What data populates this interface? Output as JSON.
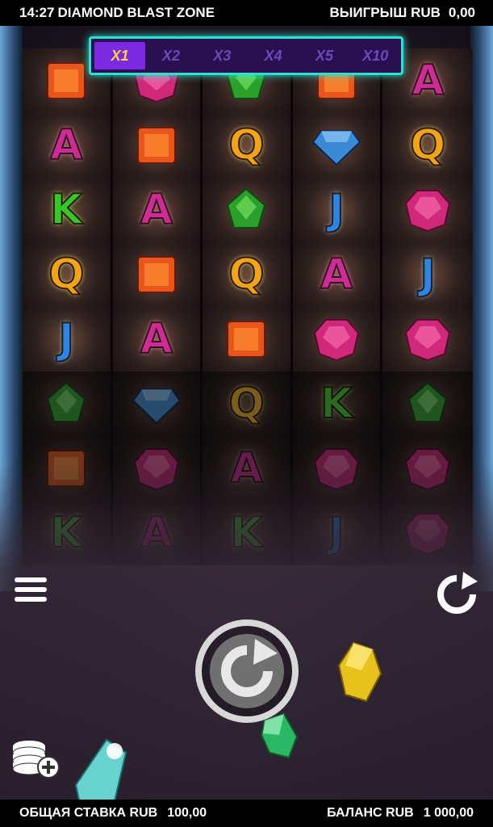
{
  "header": {
    "time": "14:27",
    "game_title": "DIAMOND BLAST ZONE",
    "win_label": "ВЫИГРЫШ RUB",
    "win_value": "0,00"
  },
  "footer": {
    "bet_label": "ОБЩАЯ СТАВКА RUB",
    "bet_value": "100,00",
    "balance_label": "БАЛАНС RUB",
    "balance_value": "1 000,00"
  },
  "multipliers": {
    "items": [
      "X1",
      "X2",
      "X3",
      "X4",
      "X5",
      "X10"
    ],
    "active_index": 0
  },
  "reels": [
    [
      "orange-gem",
      "A",
      "K",
      "Q",
      "J",
      "green-gem",
      "orange-gem",
      "K"
    ],
    [
      "pink-gem",
      "orange-gem",
      "A",
      "orange-gem",
      "A",
      "blue-diamond",
      "pink-gem",
      "A"
    ],
    [
      "green-gem",
      "Q",
      "green-gem",
      "Q",
      "orange-gem",
      "Q",
      "A",
      "K"
    ],
    [
      "orange-gem",
      "blue-diamond",
      "J",
      "A",
      "pink-gem",
      "K",
      "pink-gem",
      "J"
    ],
    [
      "A",
      "Q",
      "pink-gem",
      "J",
      "pink-gem",
      "green-gem",
      "pink-gem",
      "pink-gem"
    ]
  ],
  "colors": {
    "pink": "#d0287a",
    "orange": "#e8561a",
    "green": "#2aa02a",
    "blue": "#3a8ad6",
    "multiplier_frame": "#2ee0d0",
    "active_multiplier": "#ffd23a"
  },
  "icons": {
    "menu": "hamburger-icon",
    "autoplay": "refresh-icon",
    "spin": "spin-icon",
    "bet": "coins-plus-icon"
  }
}
